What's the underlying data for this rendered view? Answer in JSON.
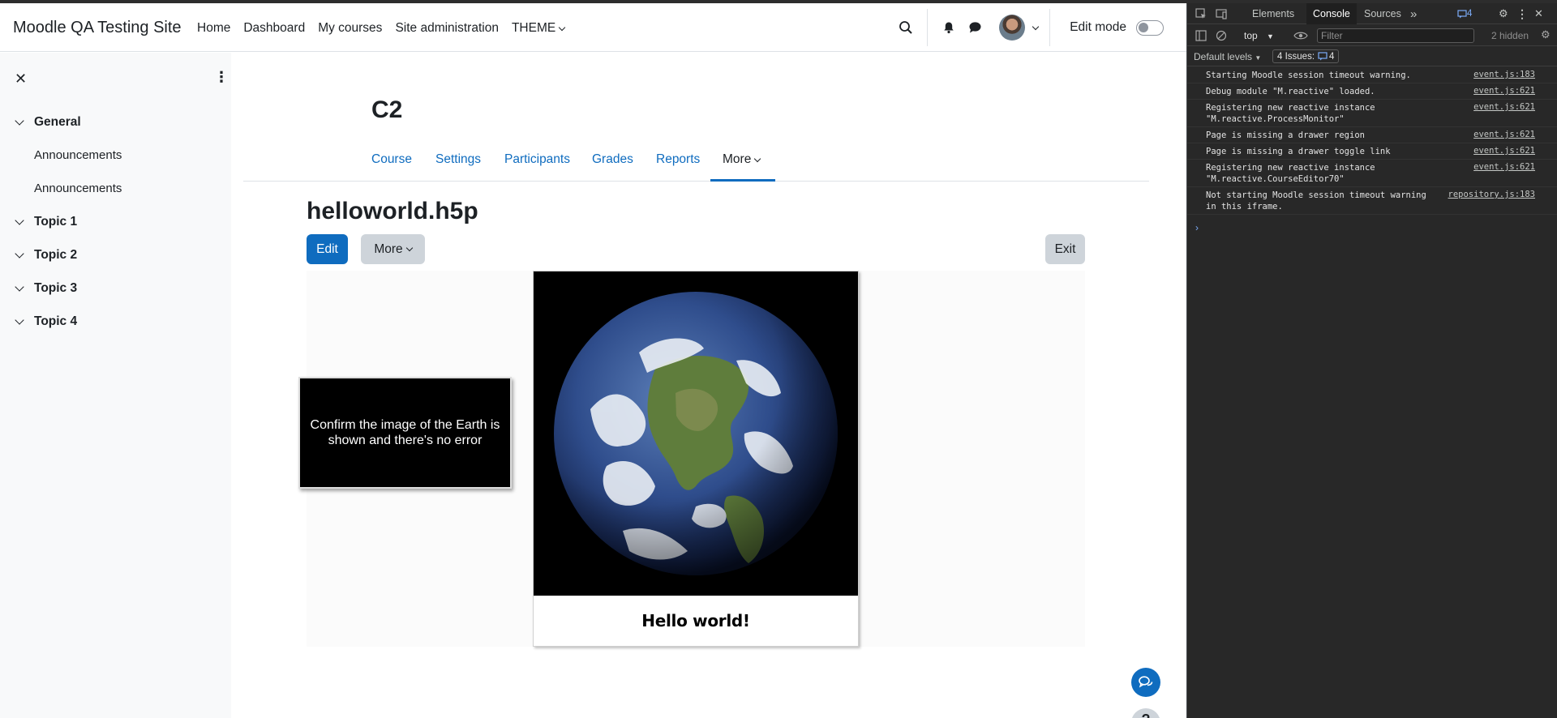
{
  "navbar": {
    "brand": "Moodle QA Testing Site",
    "links": [
      "Home",
      "Dashboard",
      "My courses",
      "Site administration",
      "THEME"
    ],
    "edit_mode_label": "Edit mode"
  },
  "drawer": {
    "sections": [
      {
        "title": "General",
        "items": [
          "Announcements",
          "Announcements"
        ]
      },
      {
        "title": "Topic 1"
      },
      {
        "title": "Topic 2"
      },
      {
        "title": "Topic 3"
      },
      {
        "title": "Topic 4"
      }
    ]
  },
  "course": {
    "title": "C2",
    "tabs": [
      "Course",
      "Settings",
      "Participants",
      "Grades",
      "Reports",
      "More"
    ]
  },
  "activity": {
    "title": "helloworld.h5p",
    "edit_label": "Edit",
    "more_label": "More",
    "exit_label": "Exit",
    "note": "Confirm the image of the Earth is shown and there's no error",
    "caption": "Hello world!"
  },
  "devtools": {
    "tabs": [
      "Elements",
      "Console",
      "Sources"
    ],
    "issues_count": "4",
    "context": "top",
    "filter_placeholder": "Filter",
    "hidden": "2 hidden",
    "levels": "Default levels",
    "issues_label": "4 Issues:",
    "issues_badge": "4",
    "logs": [
      {
        "msg": "Starting Moodle session timeout warning.",
        "src": "event.js:183"
      },
      {
        "msg": "Debug module \"M.reactive\" loaded.",
        "src": "event.js:621"
      },
      {
        "msg": "Registering new reactive instance\n\"M.reactive.ProcessMonitor\"",
        "src": "event.js:621"
      },
      {
        "msg": "Page is missing a drawer region",
        "src": "event.js:621"
      },
      {
        "msg": "Page is missing a drawer toggle link",
        "src": "event.js:621"
      },
      {
        "msg": "Registering new reactive instance\n\"M.reactive.CourseEditor70\"",
        "src": "event.js:621"
      },
      {
        "msg": "Not starting Moodle session timeout warning\nin this iframe.",
        "src": "repository.js:183"
      }
    ]
  }
}
